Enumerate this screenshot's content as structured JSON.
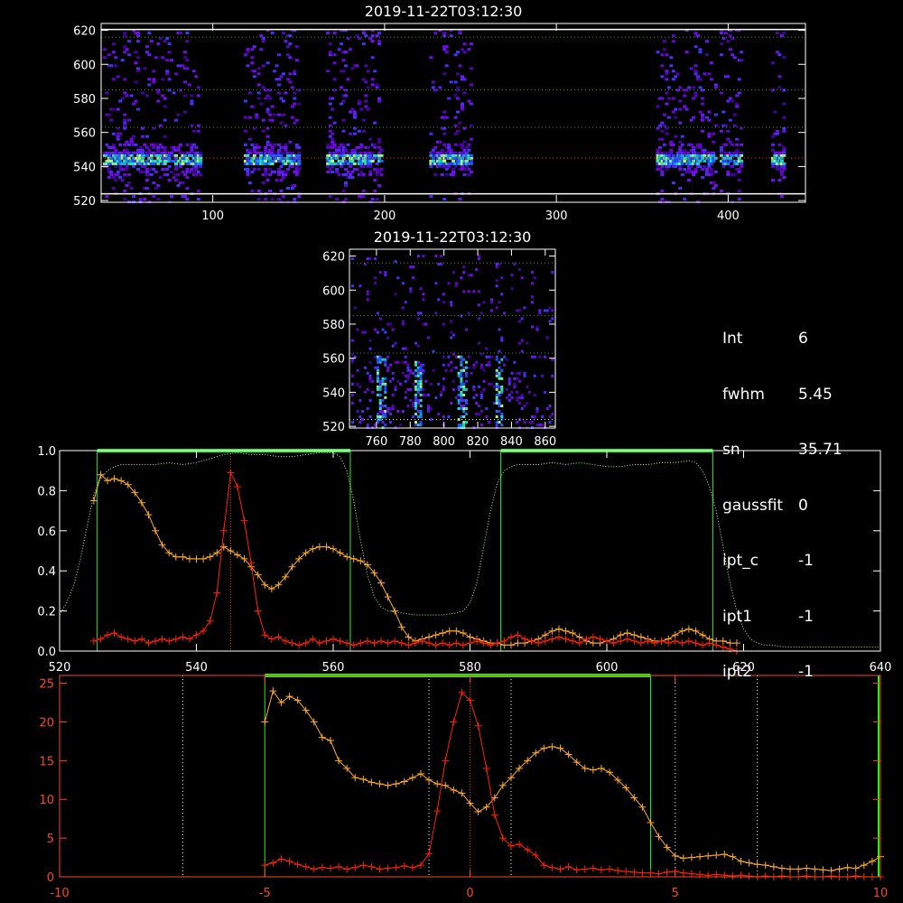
{
  "top_panel": {
    "title": "2019-11-22T03:12:30",
    "x_ticks": [
      100,
      200,
      300,
      400
    ],
    "y_ticks": [
      520,
      540,
      560,
      580,
      600,
      620
    ],
    "xlim": [
      35,
      445
    ],
    "ylim": [
      519,
      624
    ],
    "hlines": [
      {
        "y": 616,
        "color": "#22aa22"
      },
      {
        "y": 585,
        "color": "#22aa22"
      },
      {
        "y": 563,
        "color": "#22aa22"
      },
      {
        "y": 545,
        "color": "#ff3300"
      }
    ],
    "white_lines": [
      620.5,
      524
    ],
    "emission_columns": [
      [
        36,
        92
      ],
      [
        118,
        150
      ],
      [
        166,
        198
      ],
      [
        226,
        250
      ],
      [
        358,
        392
      ],
      [
        395,
        408
      ],
      [
        425,
        432
      ]
    ]
  },
  "mid_panel": {
    "title": "2019-11-22T03:12:30",
    "x_ticks": [
      760,
      780,
      800,
      820,
      840,
      860
    ],
    "y_ticks": [
      520,
      540,
      560,
      580,
      600,
      620
    ],
    "xlim": [
      744,
      866
    ],
    "ylim": [
      519,
      624
    ],
    "hlines": [
      {
        "y": 616,
        "color": "#22aa22"
      },
      {
        "y": 585,
        "color": "#22aa22"
      },
      {
        "y": 563,
        "color": "#22aa22"
      },
      {
        "y": 524,
        "color": "#ffffff"
      }
    ],
    "streaks": [
      762,
      784,
      810,
      832
    ]
  },
  "info": [
    {
      "key": "Int",
      "value": "6"
    },
    {
      "key": "fwhm",
      "value": "5.45"
    },
    {
      "key": "sn",
      "value": "35.71"
    },
    {
      "key": "gaussfit",
      "value": "0"
    },
    {
      "key": "ipt_c",
      "value": "-1"
    },
    {
      "key": "ipt1",
      "value": "-1"
    },
    {
      "key": "ipt2",
      "value": "-1"
    }
  ],
  "chart_data": [
    {
      "type": "line",
      "xlim": [
        520,
        640
      ],
      "ylim": [
        0,
        1.0
      ],
      "x_ticks": [
        520,
        540,
        560,
        580,
        600,
        620,
        640
      ],
      "y_tick_labels": [
        "0.0",
        "0.2",
        "0.4",
        "0.6",
        "0.8",
        "1.0"
      ],
      "filter_boxes": [
        [
          525.5,
          562.5
        ],
        [
          584.5,
          615.5
        ]
      ],
      "vline": 545,
      "series": [
        {
          "color": "#ffaa22",
          "x": [
            525,
            526,
            527,
            528,
            529,
            530,
            531,
            532,
            533,
            534,
            535,
            536,
            537,
            538,
            539,
            540,
            541,
            542,
            543,
            544,
            545,
            546,
            547,
            548,
            549,
            550,
            551,
            552,
            553,
            554,
            555,
            556,
            557,
            558,
            559,
            560,
            561,
            562,
            563,
            564,
            565,
            566,
            567,
            568,
            569,
            570,
            571,
            572,
            573,
            574,
            575,
            576,
            577,
            578,
            579,
            580,
            581,
            582,
            583,
            584,
            585,
            586,
            587,
            588,
            589,
            590,
            591,
            592,
            593,
            594,
            595,
            596,
            597,
            598,
            599,
            600,
            601,
            602,
            603,
            604,
            605,
            606,
            607,
            608,
            609,
            610,
            611,
            612,
            613,
            614,
            615,
            616,
            617,
            618,
            619
          ],
          "y": [
            0.75,
            0.88,
            0.85,
            0.86,
            0.85,
            0.83,
            0.79,
            0.74,
            0.68,
            0.6,
            0.53,
            0.49,
            0.47,
            0.47,
            0.46,
            0.46,
            0.46,
            0.47,
            0.49,
            0.52,
            0.5,
            0.48,
            0.46,
            0.42,
            0.38,
            0.33,
            0.31,
            0.33,
            0.37,
            0.42,
            0.46,
            0.49,
            0.51,
            0.52,
            0.52,
            0.51,
            0.49,
            0.47,
            0.46,
            0.45,
            0.43,
            0.39,
            0.34,
            0.27,
            0.2,
            0.12,
            0.07,
            0.05,
            0.06,
            0.07,
            0.08,
            0.09,
            0.1,
            0.1,
            0.09,
            0.07,
            0.06,
            0.05,
            0.04,
            0.04,
            0.03,
            0.03,
            0.04,
            0.04,
            0.05,
            0.06,
            0.08,
            0.1,
            0.11,
            0.1,
            0.09,
            0.07,
            0.05,
            0.04,
            0.04,
            0.05,
            0.06,
            0.08,
            0.09,
            0.08,
            0.07,
            0.06,
            0.05,
            0.05,
            0.06,
            0.08,
            0.1,
            0.11,
            0.1,
            0.08,
            0.06,
            0.05,
            0.05,
            0.04,
            0.04
          ]
        },
        {
          "color": "#ff2200",
          "x": [
            525,
            526,
            527,
            528,
            529,
            530,
            531,
            532,
            533,
            534,
            535,
            536,
            537,
            538,
            539,
            540,
            541,
            542,
            543,
            544,
            545,
            546,
            547,
            548,
            549,
            550,
            551,
            552,
            553,
            554,
            555,
            556,
            557,
            558,
            559,
            560,
            561,
            562,
            563,
            564,
            565,
            566,
            567,
            568,
            569,
            570,
            571,
            572,
            573,
            574,
            575,
            576,
            577,
            578,
            579,
            580,
            581,
            582,
            583,
            584,
            585,
            586,
            587,
            588,
            589,
            590,
            591,
            592,
            593,
            594,
            595,
            596,
            597,
            598,
            599,
            600,
            601,
            602,
            603,
            604,
            605,
            606,
            607,
            608,
            609,
            610,
            611,
            612,
            613,
            614,
            615,
            616,
            617,
            618,
            619
          ],
          "y": [
            0.05,
            0.06,
            0.08,
            0.09,
            0.07,
            0.06,
            0.05,
            0.06,
            0.04,
            0.05,
            0.06,
            0.05,
            0.06,
            0.07,
            0.06,
            0.08,
            0.1,
            0.15,
            0.29,
            0.6,
            0.89,
            0.82,
            0.65,
            0.44,
            0.2,
            0.08,
            0.06,
            0.07,
            0.05,
            0.04,
            0.03,
            0.04,
            0.06,
            0.04,
            0.05,
            0.06,
            0.05,
            0.04,
            0.03,
            0.04,
            0.05,
            0.04,
            0.05,
            0.04,
            0.05,
            0.04,
            0.03,
            0.04,
            0.05,
            0.04,
            0.03,
            0.04,
            0.03,
            0.04,
            0.03,
            0.04,
            0.05,
            0.04,
            0.03,
            0.04,
            0.05,
            0.07,
            0.08,
            0.06,
            0.05,
            0.04,
            0.05,
            0.06,
            0.07,
            0.06,
            0.05,
            0.04,
            0.06,
            0.07,
            0.06,
            0.05,
            0.04,
            0.05,
            0.06,
            0.05,
            0.04,
            0.05,
            0.04,
            0.05,
            0.04,
            0.05,
            0.04,
            0.05,
            0.04,
            0.03,
            0.04,
            0.03,
            0.02,
            0.01,
            0.0
          ]
        },
        {
          "color": "#aaff88",
          "dotted": true,
          "x": [
            520,
            521,
            522,
            523,
            524,
            525,
            526,
            527,
            528,
            529,
            530,
            532,
            534,
            536,
            538,
            540,
            542,
            544,
            546,
            548,
            550,
            552,
            554,
            556,
            558,
            560,
            561,
            562,
            563,
            564,
            565,
            566,
            567,
            568,
            570,
            572,
            574,
            576,
            578,
            579,
            580,
            581,
            582,
            583,
            584,
            585,
            586,
            587,
            588,
            590,
            592,
            594,
            596,
            598,
            600,
            602,
            604,
            606,
            608,
            610,
            612,
            613,
            614,
            615,
            616,
            617,
            618,
            619,
            620,
            621,
            622,
            623,
            624,
            626,
            628,
            630,
            632,
            634,
            636,
            638,
            640
          ],
          "y": [
            0.18,
            0.24,
            0.32,
            0.45,
            0.62,
            0.78,
            0.86,
            0.9,
            0.92,
            0.93,
            0.93,
            0.93,
            0.93,
            0.94,
            0.93,
            0.94,
            0.96,
            0.98,
            0.99,
            0.98,
            0.98,
            0.97,
            0.97,
            0.98,
            0.99,
            0.99,
            0.97,
            0.9,
            0.75,
            0.55,
            0.38,
            0.27,
            0.22,
            0.2,
            0.19,
            0.18,
            0.18,
            0.18,
            0.19,
            0.2,
            0.24,
            0.34,
            0.52,
            0.7,
            0.84,
            0.9,
            0.92,
            0.93,
            0.93,
            0.93,
            0.94,
            0.93,
            0.94,
            0.93,
            0.92,
            0.92,
            0.93,
            0.93,
            0.94,
            0.94,
            0.95,
            0.94,
            0.9,
            0.82,
            0.7,
            0.52,
            0.34,
            0.2,
            0.11,
            0.06,
            0.04,
            0.03,
            0.03,
            0.02,
            0.02,
            0.02,
            0.02,
            0.02,
            0.02,
            0.02,
            0.02
          ]
        }
      ]
    },
    {
      "type": "line",
      "xlim": [
        -10,
        10
      ],
      "ylim": [
        0,
        26
      ],
      "x_ticks": [
        -10,
        -5,
        0,
        5,
        10
      ],
      "y_tick_labels": [
        "0",
        "5",
        "10",
        "15",
        "20",
        "25"
      ],
      "filter_box": [
        -5,
        4.4
      ],
      "dotted_vlines": [
        -7,
        -1,
        1,
        5,
        7
      ],
      "vline": 0,
      "series": [
        {
          "color": "#ffaa22",
          "x": [
            -5.0,
            -4.8,
            -4.6,
            -4.4,
            -4.2,
            -4.0,
            -3.8,
            -3.6,
            -3.4,
            -3.2,
            -3.0,
            -2.8,
            -2.6,
            -2.4,
            -2.2,
            -2.0,
            -1.8,
            -1.6,
            -1.4,
            -1.2,
            -1.0,
            -0.8,
            -0.6,
            -0.4,
            -0.2,
            0.0,
            0.2,
            0.4,
            0.6,
            0.8,
            1.0,
            1.2,
            1.4,
            1.6,
            1.8,
            2.0,
            2.2,
            2.4,
            2.6,
            2.8,
            3.0,
            3.2,
            3.4,
            3.6,
            3.8,
            4.0,
            4.2,
            4.4,
            4.6,
            4.8,
            5.0,
            5.2,
            5.4,
            5.6,
            5.8,
            6.0,
            6.2,
            6.4,
            6.6,
            6.8,
            7.0,
            7.2,
            7.4,
            7.6,
            7.8,
            8.0,
            8.2,
            8.4,
            8.6,
            8.8,
            9.0,
            9.2,
            9.4,
            9.6,
            9.8,
            10.0
          ],
          "y": [
            20.0,
            24.0,
            22.5,
            23.3,
            22.8,
            21.5,
            20.0,
            18.0,
            17.6,
            15.0,
            14.0,
            12.8,
            12.6,
            12.2,
            12.0,
            11.8,
            12.0,
            12.3,
            12.8,
            13.3,
            12.5,
            12.0,
            11.8,
            11.2,
            10.8,
            9.5,
            8.4,
            9.0,
            10.2,
            11.8,
            12.8,
            14.0,
            15.0,
            16.0,
            16.6,
            16.8,
            16.6,
            15.8,
            14.8,
            14.0,
            13.8,
            14.0,
            13.5,
            12.5,
            11.5,
            10.2,
            9.0,
            7.0,
            5.2,
            3.8,
            2.7,
            2.4,
            2.5,
            2.6,
            2.7,
            2.8,
            2.9,
            2.6,
            2.0,
            1.8,
            1.6,
            1.5,
            1.3,
            1.1,
            1.0,
            1.0,
            1.1,
            1.0,
            0.9,
            0.8,
            1.0,
            1.2,
            1.1,
            1.5,
            2.0,
            2.6
          ]
        },
        {
          "color": "#ff2200",
          "x": [
            -5.0,
            -4.8,
            -4.6,
            -4.4,
            -4.2,
            -4.0,
            -3.8,
            -3.6,
            -3.4,
            -3.2,
            -3.0,
            -2.8,
            -2.6,
            -2.4,
            -2.2,
            -2.0,
            -1.8,
            -1.6,
            -1.4,
            -1.2,
            -1.0,
            -0.8,
            -0.6,
            -0.4,
            -0.2,
            0.0,
            0.2,
            0.4,
            0.6,
            0.8,
            1.0,
            1.2,
            1.4,
            1.6,
            1.8,
            2.0,
            2.2,
            2.4,
            2.6,
            2.8,
            3.0,
            3.2,
            3.4,
            3.6,
            3.8,
            4.0,
            4.2,
            4.4,
            4.6,
            4.8,
            5.0,
            5.2,
            5.4,
            5.6,
            5.8,
            6.0,
            6.2,
            6.4,
            6.6,
            6.8,
            7.0,
            7.2,
            7.4,
            7.6,
            7.8,
            8.0,
            8.2,
            8.4,
            8.6,
            8.8,
            9.0,
            9.2,
            9.4,
            9.6,
            9.8,
            10.0
          ],
          "y": [
            1.5,
            1.8,
            2.3,
            2.0,
            1.6,
            1.3,
            1.0,
            1.2,
            1.1,
            1.3,
            1.0,
            1.2,
            1.5,
            1.3,
            1.0,
            1.1,
            1.2,
            1.4,
            1.2,
            1.5,
            3.0,
            8.5,
            15.0,
            20.0,
            23.8,
            22.8,
            19.5,
            14.0,
            8.0,
            5.0,
            4.0,
            4.2,
            3.5,
            2.8,
            1.5,
            1.2,
            1.0,
            1.3,
            0.9,
            1.0,
            1.1,
            0.9,
            1.0,
            0.8,
            0.7,
            0.6,
            0.5,
            0.5,
            0.4,
            0.6,
            0.7,
            0.5,
            0.4,
            0.3,
            0.2,
            0.3,
            0.2,
            0.1,
            0.2,
            0.1,
            0.0,
            0.1,
            0.0,
            0.1,
            0.0,
            0.0,
            0.1,
            0.0,
            0.0,
            0.1,
            0.0,
            0.0,
            0.1,
            0.0,
            0.0,
            0.0
          ]
        }
      ]
    }
  ]
}
